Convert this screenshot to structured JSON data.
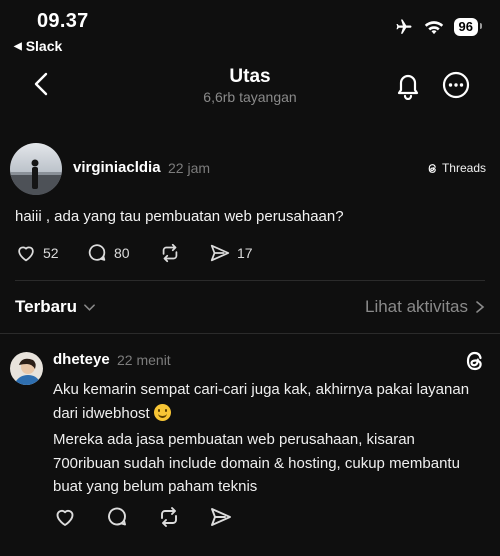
{
  "status_bar": {
    "time": "09.37",
    "back_app": "Slack",
    "battery": "96",
    "icons": [
      "airplane-icon",
      "wifi-icon",
      "battery-icon"
    ]
  },
  "header": {
    "title": "Utas",
    "subtitle": "6,6rb tayangan",
    "icons": [
      "back-chevron-icon",
      "bell-icon",
      "more-icon"
    ]
  },
  "post": {
    "username": "virginiacldia",
    "time": "22 jam",
    "threads_label": "Threads",
    "text": "haiii , ada yang tau pembuatan web perusahaan?",
    "likes": "52",
    "comments": "80",
    "shares": "17"
  },
  "sort_bar": {
    "sort_label": "Terbaru",
    "activity_label": "Lihat aktivitas"
  },
  "reply": {
    "username": "dheteye",
    "time": "22 menit",
    "paragraph1": "Aku kemarin sempat cari-cari juga kak, akhirnya pakai layanan dari idwebhost",
    "paragraph2": "Mereka ada jasa pembuatan web perusahaan, kisaran 700ribuan sudah include domain & hosting, cukup membantu buat yang belum paham teknis"
  },
  "colors": {
    "background": "#0f0f0f",
    "text": "#f3f3f3",
    "muted": "#8a8a8a",
    "divider": "#2b2b2b"
  }
}
